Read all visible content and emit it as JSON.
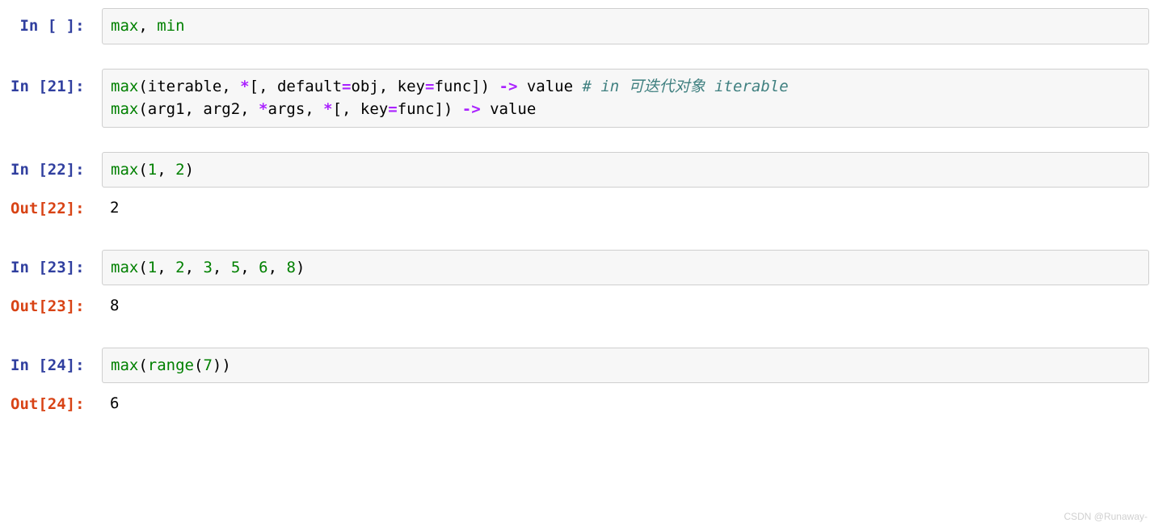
{
  "cells": [
    {
      "kind": "in",
      "prompt": "In [ ]: "
    },
    {
      "kind": "gap"
    },
    {
      "kind": "in",
      "prompt": "In [21]: "
    },
    {
      "kind": "gap"
    },
    {
      "kind": "in",
      "prompt": "In [22]: "
    },
    {
      "kind": "out",
      "prompt": "Out[22]: ",
      "text": "2"
    },
    {
      "kind": "gap"
    },
    {
      "kind": "in",
      "prompt": "In [23]: "
    },
    {
      "kind": "out",
      "prompt": "Out[23]: ",
      "text": "8"
    },
    {
      "kind": "gap"
    },
    {
      "kind": "in",
      "prompt": "In [24]: "
    },
    {
      "kind": "out",
      "prompt": "Out[24]: ",
      "text": "6"
    }
  ],
  "code": {
    "c0": {
      "t0": "max",
      "t1": ", ",
      "t2": "min"
    },
    "c1": {
      "l1": {
        "t0": "max",
        "t1": "(iterable, ",
        "t2": "*",
        "t3": "[, default",
        "t4": "=",
        "t5": "obj, key",
        "t6": "=",
        "t7": "func]) ",
        "t8": "->",
        "t9": " value ",
        "t10": "# in 可迭代对象 iterable"
      },
      "l2": {
        "t0": "max",
        "t1": "(arg1, arg2, ",
        "t2": "*",
        "t3": "args, ",
        "t4": "*",
        "t5": "[, key",
        "t6": "=",
        "t7": "func]) ",
        "t8": "->",
        "t9": " value"
      }
    },
    "c2": {
      "t0": "max",
      "t1": "(",
      "t2": "1",
      "t3": ", ",
      "t4": "2",
      "t5": ")"
    },
    "c3": {
      "t0": "max",
      "t1": "(",
      "t2": "1",
      "t3": ", ",
      "t4": "2",
      "t5": ", ",
      "t6": "3",
      "t7": ", ",
      "t8": "5",
      "t9": ", ",
      "t10": "6",
      "t11": ", ",
      "t12": "8",
      "t13": ")"
    },
    "c4": {
      "t0": "max",
      "t1": "(",
      "t2": "range",
      "t3": "(",
      "t4": "7",
      "t5": "))"
    }
  },
  "watermark": "CSDN @Runaway-"
}
